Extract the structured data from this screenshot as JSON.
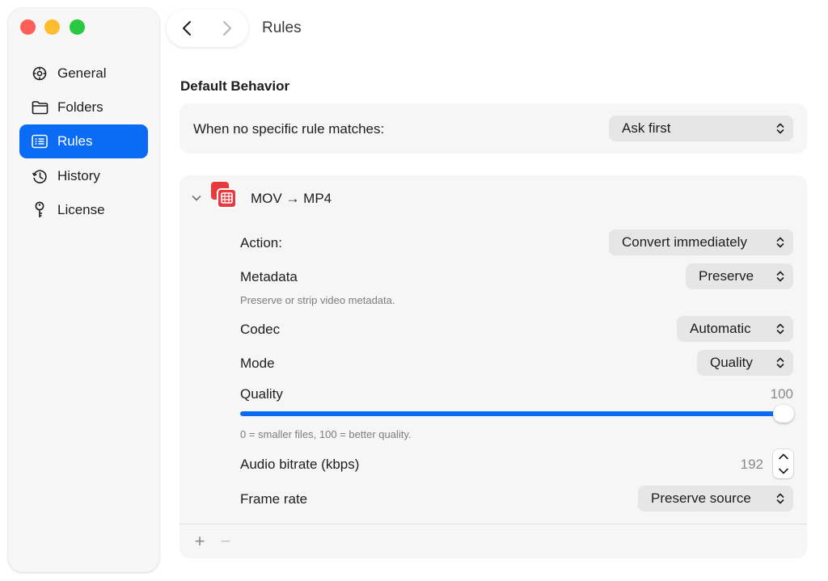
{
  "window": {
    "title": "Rules"
  },
  "sidebar": {
    "items": [
      {
        "label": "General",
        "icon": "gear-icon",
        "active": false
      },
      {
        "label": "Folders",
        "icon": "folder-icon",
        "active": false
      },
      {
        "label": "Rules",
        "icon": "list-icon",
        "active": true
      },
      {
        "label": "History",
        "icon": "clock-history-icon",
        "active": false
      },
      {
        "label": "License",
        "icon": "key-icon",
        "active": false
      }
    ]
  },
  "default_behavior": {
    "section_title": "Default Behavior",
    "label": "When no specific rule matches:",
    "value": "Ask first"
  },
  "rule": {
    "name": "MOV → MP4",
    "expanded": true,
    "action": {
      "label": "Action:",
      "value": "Convert immediately"
    },
    "metadata": {
      "label": "Metadata",
      "value": "Preserve",
      "hint": "Preserve or strip video metadata."
    },
    "codec": {
      "label": "Codec",
      "value": "Automatic"
    },
    "mode": {
      "label": "Mode",
      "value": "Quality"
    },
    "quality": {
      "label": "Quality",
      "value": "100",
      "level": 100,
      "min": 0,
      "max": 100,
      "hint": "0 = smaller files, 100 = better quality."
    },
    "audio_bitrate": {
      "label": "Audio bitrate (kbps)",
      "value": "192"
    },
    "frame_rate": {
      "label": "Frame rate",
      "value": "Preserve source"
    }
  },
  "footer": {
    "add_label": "+",
    "remove_label": "−"
  },
  "colors": {
    "accent": "#0a6cf5",
    "close": "#fe5f57",
    "minimize": "#febc2e",
    "zoom": "#28c840",
    "rule_icon": "#e8393f"
  }
}
